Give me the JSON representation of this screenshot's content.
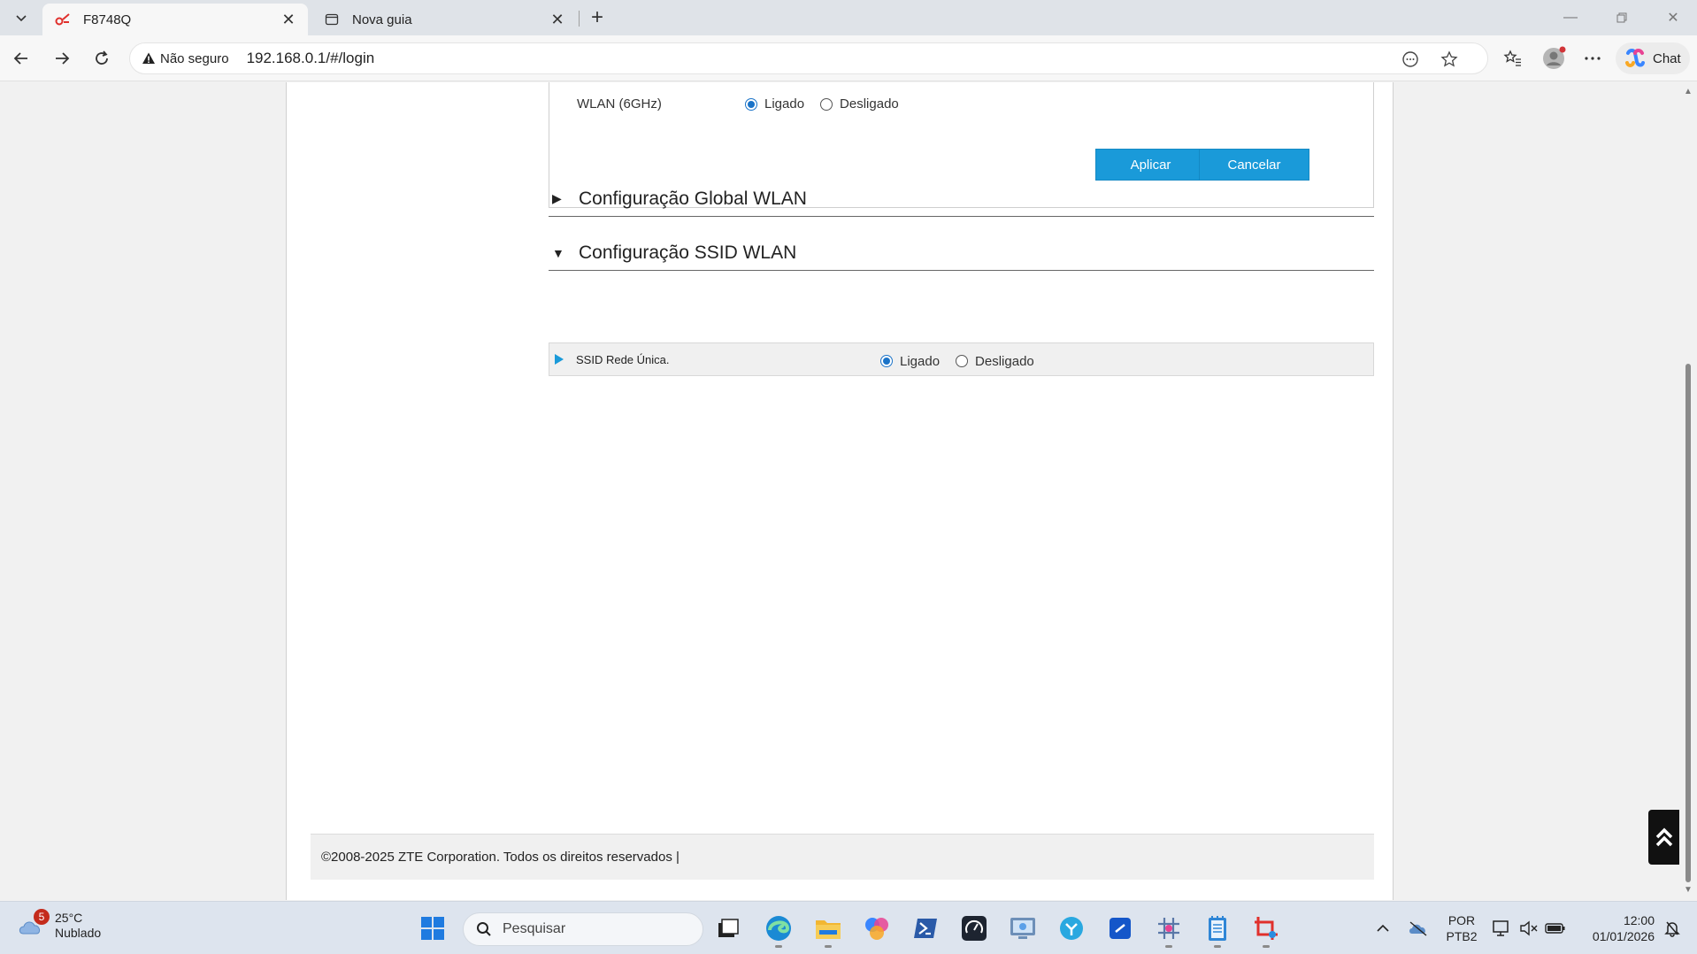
{
  "browser": {
    "tabs": [
      {
        "title": "F8748Q",
        "active": true
      },
      {
        "title": "Nova guia",
        "active": false
      }
    ],
    "address": {
      "security_label": "Não seguro",
      "url": "192.168.0.1/#/login"
    },
    "chat_label": "Chat"
  },
  "page": {
    "wlan_row": {
      "label": "WLAN (6GHz)",
      "on_label": "Ligado",
      "off_label": "Desligado",
      "selected": "Ligado"
    },
    "buttons": {
      "apply": "Aplicar",
      "cancel": "Cancelar"
    },
    "sections": {
      "global": {
        "title": "Configuração Global WLAN",
        "expanded": false
      },
      "ssid": {
        "title": "Configuração SSID WLAN",
        "expanded": true
      }
    },
    "ssid_row": {
      "label": "SSID Rede Única.",
      "on_label": "Ligado",
      "off_label": "Desligado",
      "selected": "Ligado"
    },
    "footer": "©2008-2025 ZTE Corporation. Todos os direitos reservados  |"
  },
  "taskbar": {
    "weather": {
      "badge": "5",
      "temp": "25°C",
      "condition": "Nublado"
    },
    "search_placeholder": "Pesquisar",
    "language": {
      "line1": "POR",
      "line2": "PTB2"
    },
    "clock": {
      "time": "12:00",
      "date": "01/01/2026"
    }
  },
  "colors": {
    "accent": "#1a9ad9",
    "radio_on": "#1a73c8",
    "taskbar": "#dde4ee"
  }
}
